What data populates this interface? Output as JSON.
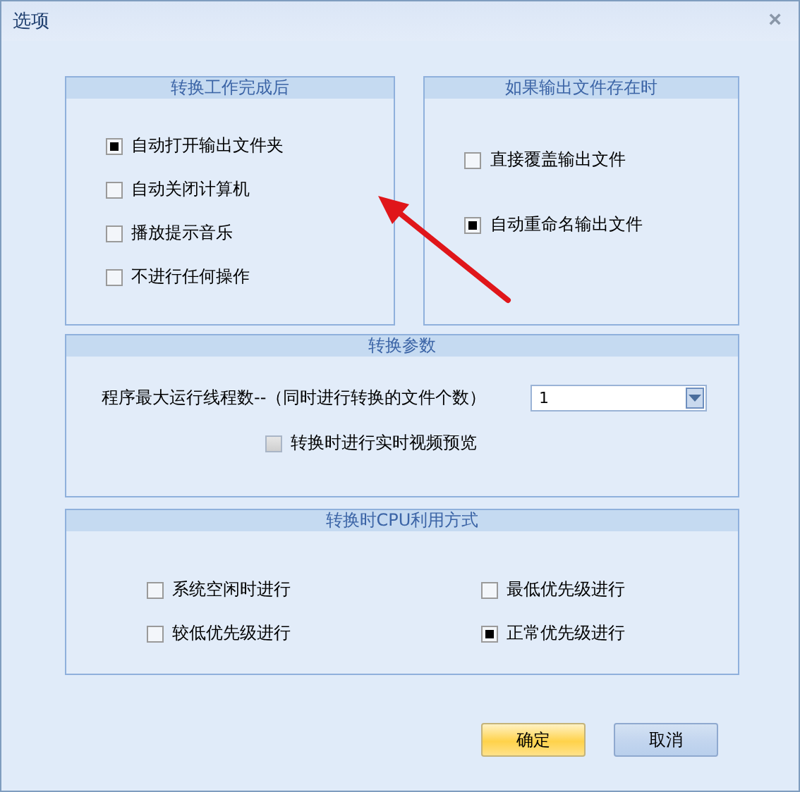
{
  "window": {
    "title": "选项",
    "close": "×"
  },
  "after_convert": {
    "title": "转换工作完成后",
    "options": [
      {
        "label": "自动打开输出文件夹",
        "checked": true
      },
      {
        "label": "自动关闭计算机",
        "checked": false
      },
      {
        "label": "播放提示音乐",
        "checked": false
      },
      {
        "label": "不进行任何操作",
        "checked": false
      }
    ]
  },
  "if_exists": {
    "title": "如果输出文件存在时",
    "options": [
      {
        "label": "直接覆盖输出文件",
        "checked": false
      },
      {
        "label": "自动重命名输出文件",
        "checked": true
      }
    ]
  },
  "params": {
    "title": "转换参数",
    "threads_label": "程序最大运行线程数--（同时进行转换的文件个数）",
    "threads_value": "1",
    "preview": {
      "label": "转换时进行实时视频预览",
      "checked": false,
      "disabled": true
    }
  },
  "cpu": {
    "title": "转换时CPU利用方式",
    "options": [
      {
        "label": "系统空闲时进行",
        "checked": false
      },
      {
        "label": "最低优先级进行",
        "checked": false
      },
      {
        "label": "较低优先级进行",
        "checked": false
      },
      {
        "label": "正常优先级进行",
        "checked": true
      }
    ]
  },
  "buttons": [
    {
      "label": "确定",
      "kind": "primary"
    },
    {
      "label": "取消",
      "kind": "normal"
    }
  ]
}
